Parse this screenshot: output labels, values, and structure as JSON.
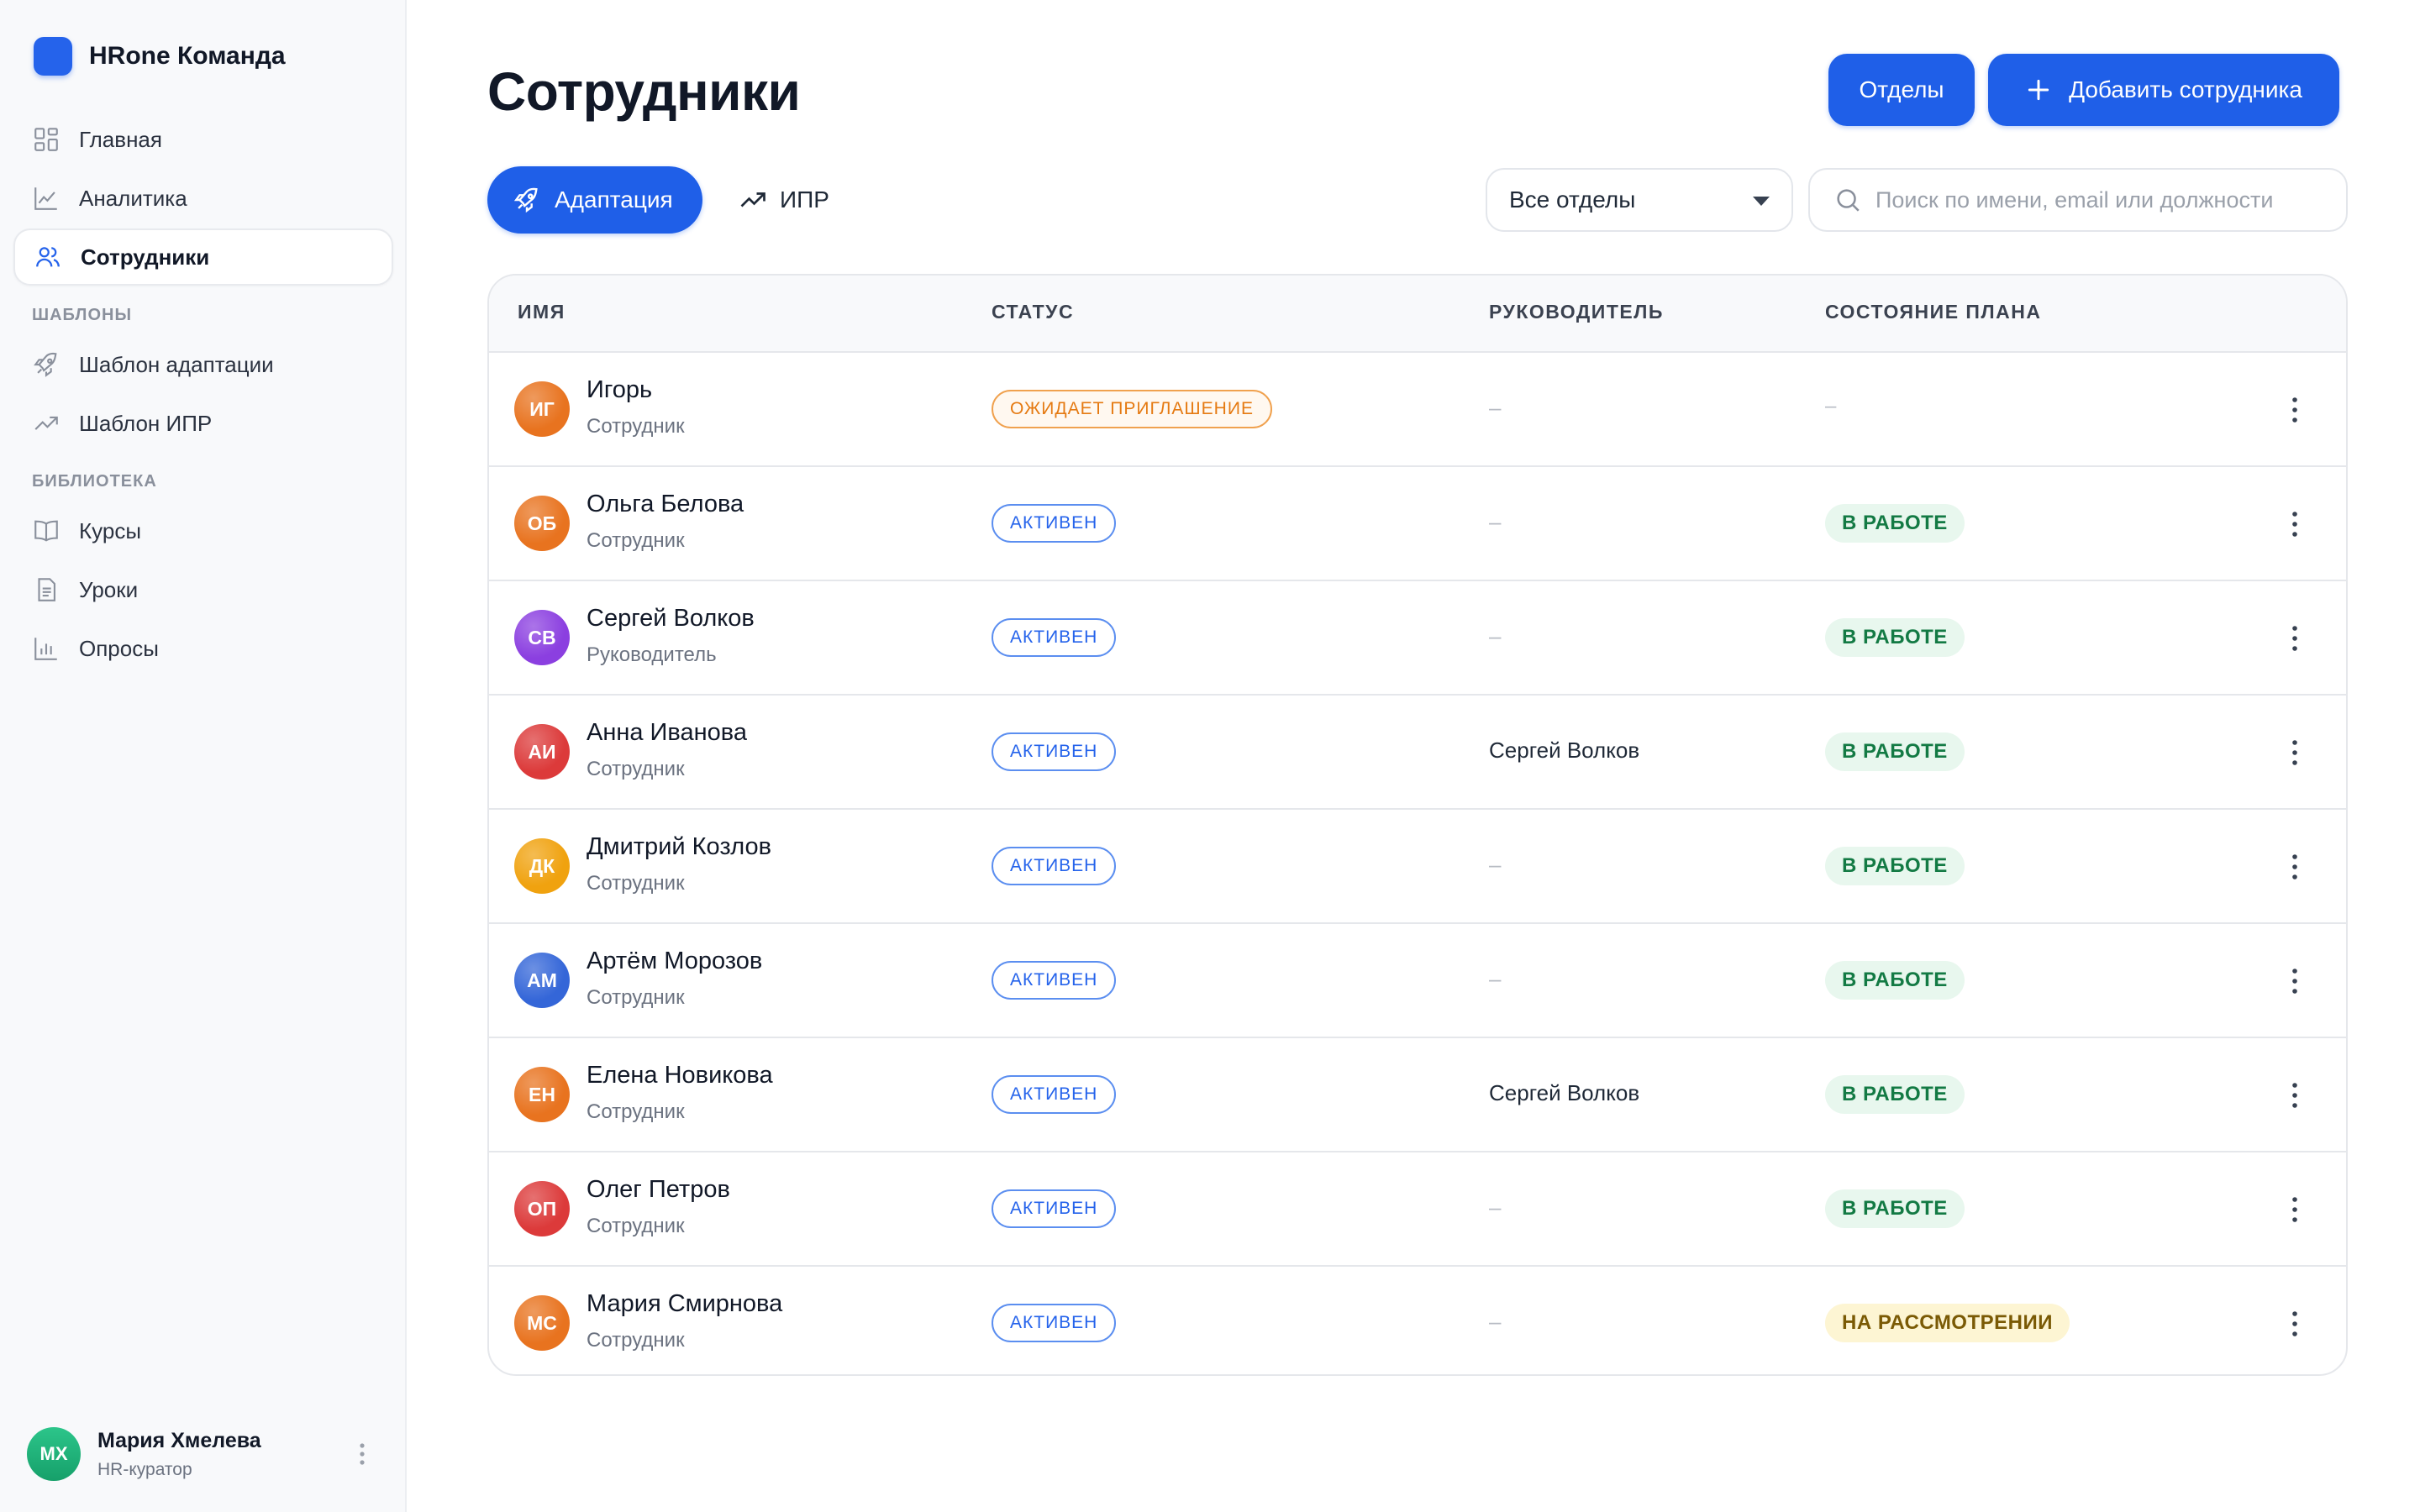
{
  "app": {
    "name": "HRone Команда",
    "brand_color": "#2563eb"
  },
  "sidebar": {
    "nav": [
      {
        "label": "Главная",
        "icon": "grid-icon"
      },
      {
        "label": "Аналитика",
        "icon": "line-chart-icon"
      },
      {
        "label": "Сотрудники",
        "icon": "users-icon",
        "active": true
      }
    ],
    "sections": [
      {
        "title": "ШАБЛОНЫ",
        "items": [
          {
            "label": "Шаблон адаптации",
            "icon": "rocket-icon"
          },
          {
            "label": "Шаблон ИПР",
            "icon": "trend-icon"
          }
        ]
      },
      {
        "title": "БИБЛИОТЕКА",
        "items": [
          {
            "label": "Курсы",
            "icon": "book-icon"
          },
          {
            "label": "Уроки",
            "icon": "document-icon"
          },
          {
            "label": "Опросы",
            "icon": "bar-chart-icon"
          }
        ]
      }
    ],
    "user": {
      "initials": "МХ",
      "name": "Мария Хмелева",
      "role": "HR-куратор"
    }
  },
  "page": {
    "title": "Сотрудники",
    "departments_button": "Отделы",
    "add_button": "Добавить сотрудника",
    "tabs": [
      {
        "label": "Адаптация",
        "icon": "rocket-icon",
        "active": true
      },
      {
        "label": "ИПР",
        "icon": "trend-icon",
        "active": false
      }
    ],
    "filter": {
      "selected": "Все отделы"
    },
    "search": {
      "placeholder": "Поиск по имени, email или должности",
      "value": ""
    }
  },
  "table": {
    "columns": [
      "ИМЯ",
      "СТАТУС",
      "РУКОВОДИТЕЛЬ",
      "СОСТОЯНИЕ ПЛАНА"
    ],
    "rows": [
      {
        "initials": "ИГ",
        "name": "Игорь",
        "role": "Сотрудник",
        "status": "ОЖИДАЕТ ПРИГЛАШЕНИЕ",
        "status_type": "invite",
        "manager": "–",
        "plan": "–",
        "plan_type": "dash",
        "avatar": "#e8731f"
      },
      {
        "initials": "ОБ",
        "name": "Ольга Белова",
        "role": "Сотрудник",
        "status": "АКТИВЕН",
        "status_type": "active",
        "manager": "–",
        "plan": "В РАБОТЕ",
        "plan_type": "work",
        "avatar": "#e8731f"
      },
      {
        "initials": "СВ",
        "name": "Сергей Волков",
        "role": "Руководитель",
        "status": "АКТИВЕН",
        "status_type": "active",
        "manager": "–",
        "plan": "В РАБОТЕ",
        "plan_type": "work",
        "avatar": "#8b3fe0"
      },
      {
        "initials": "АИ",
        "name": "Анна Иванова",
        "role": "Сотрудник",
        "status": "АКТИВЕН",
        "status_type": "active",
        "manager": "Сергей Волков",
        "plan": "В РАБОТЕ",
        "plan_type": "work",
        "avatar": "#dc3a3a"
      },
      {
        "initials": "ДК",
        "name": "Дмитрий Козлов",
        "role": "Сотрудник",
        "status": "АКТИВЕН",
        "status_type": "active",
        "manager": "–",
        "plan": "В РАБОТЕ",
        "plan_type": "work",
        "avatar": "#f0a20f"
      },
      {
        "initials": "АМ",
        "name": "Артём Морозов",
        "role": "Сотрудник",
        "status": "АКТИВЕН",
        "status_type": "active",
        "manager": "–",
        "plan": "В РАБОТЕ",
        "plan_type": "work",
        "avatar": "#3466d8"
      },
      {
        "initials": "ЕН",
        "name": "Елена Новикова",
        "role": "Сотрудник",
        "status": "АКТИВЕН",
        "status_type": "active",
        "manager": "Сергей Волков",
        "plan": "В РАБОТЕ",
        "plan_type": "work",
        "avatar": "#e8731f"
      },
      {
        "initials": "ОП",
        "name": "Олег Петров",
        "role": "Сотрудник",
        "status": "АКТИВЕН",
        "status_type": "active",
        "manager": "–",
        "plan": "В РАБОТЕ",
        "plan_type": "work",
        "avatar": "#dc3a3a"
      },
      {
        "initials": "МС",
        "name": "Мария Смирнова",
        "role": "Сотрудник",
        "status": "АКТИВЕН",
        "status_type": "active",
        "manager": "–",
        "plan": "НА РАССМОТРЕНИИ",
        "plan_type": "review",
        "avatar": "#e8731f"
      }
    ]
  }
}
